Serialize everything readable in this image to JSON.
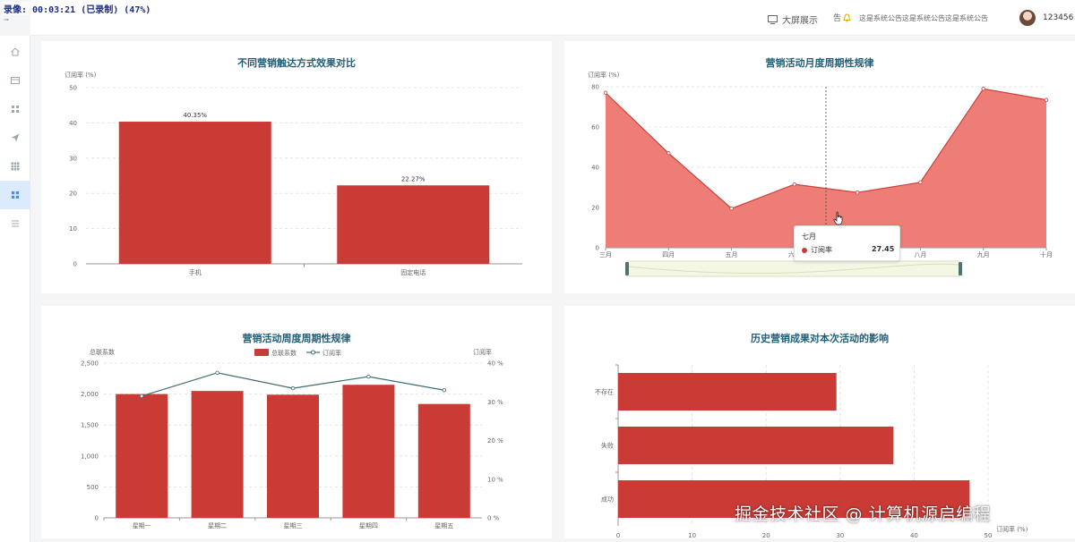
{
  "recording": {
    "overlay": "录像: 00:03:21 (已录制) (47%)",
    "sub": "⊸"
  },
  "header": {
    "big_screen_label": "大屏展示",
    "notice_label": "告",
    "notice_text": "这是系统公告这是系统公告这是系统公告",
    "username": "123456"
  },
  "sidebar": {
    "items": [
      {
        "icon": "home-icon"
      },
      {
        "icon": "card-icon"
      },
      {
        "icon": "apps-icon"
      },
      {
        "icon": "send-icon"
      },
      {
        "icon": "grid-icon"
      },
      {
        "icon": "dashboard-icon",
        "active": true
      },
      {
        "icon": "menu-icon"
      }
    ]
  },
  "colors": {
    "bar": "#cb3b35",
    "area": "#ee7d76",
    "line": "#3e6e72",
    "title": "#1f5f7a",
    "active_side": "#dbeafd"
  },
  "chart_data": [
    {
      "id": "channel",
      "type": "bar",
      "title": "不同营销触达方式效果对比",
      "ylabel": "订阅率 (%)",
      "categories": [
        "手机",
        "固定电话"
      ],
      "values": [
        40.35,
        22.27
      ],
      "data_labels": [
        "40.35%",
        "22.27%"
      ],
      "ylim": [
        0,
        50
      ],
      "yticks": [
        0,
        10,
        20,
        30,
        40,
        50
      ],
      "grid": true
    },
    {
      "id": "monthly",
      "type": "area",
      "title": "营销活动月度周期性规律",
      "ylabel": "订阅率 (%)",
      "categories": [
        "三月",
        "四月",
        "五月",
        "六月",
        "七月",
        "八月",
        "九月",
        "十月"
      ],
      "values": [
        77,
        47,
        19.5,
        31.5,
        27.45,
        32.5,
        79,
        73.5
      ],
      "ylim": [
        0,
        80
      ],
      "yticks": [
        0,
        20,
        40,
        60,
        80
      ],
      "tooltip": {
        "category": "七月",
        "series": "订阅率",
        "value": "27.45"
      },
      "data_zoom": true
    },
    {
      "id": "weekday",
      "type": "bar",
      "title": "营销活动周度周期性规律",
      "ylabel": "总联系数",
      "y2label": "订阅率",
      "legend": {
        "placement": "top-center",
        "items": [
          "总联系数",
          "订阅率"
        ]
      },
      "categories": [
        "星期一",
        "星期二",
        "星期三",
        "星期四",
        "星期五"
      ],
      "series": [
        {
          "name": "总联系数",
          "type": "bar",
          "values": [
            2000,
            2050,
            1990,
            2150,
            1840
          ]
        },
        {
          "name": "订阅率",
          "type": "line",
          "values": [
            31.5,
            37.5,
            33.5,
            36.5,
            33.0
          ]
        }
      ],
      "ylim": [
        0,
        2500
      ],
      "yticks": [
        0,
        500,
        1000,
        1500,
        2000,
        2500
      ],
      "ytick_labels": [
        "0",
        "500",
        "1,000",
        "1,500",
        "2,000",
        "2,500"
      ],
      "y2lim": [
        0,
        40
      ],
      "y2ticks": [
        0,
        10,
        20,
        30,
        40
      ],
      "y2tick_labels": [
        "0 %",
        "10 %",
        "20 %",
        "30 %",
        "40 %"
      ]
    },
    {
      "id": "history",
      "type": "bar",
      "orientation": "horizontal",
      "title": "历史营销成果对本次活动的影响",
      "xlabel": "订阅率 (%)",
      "categories": [
        "不存在",
        "失败",
        "成功"
      ],
      "values": [
        29.5,
        37.2,
        47.5
      ],
      "xlim": [
        0,
        50
      ],
      "xticks": [
        0,
        10,
        20,
        30,
        40,
        50
      ]
    }
  ],
  "watermark": "掘金技术社区 @ 计算机源启编程"
}
